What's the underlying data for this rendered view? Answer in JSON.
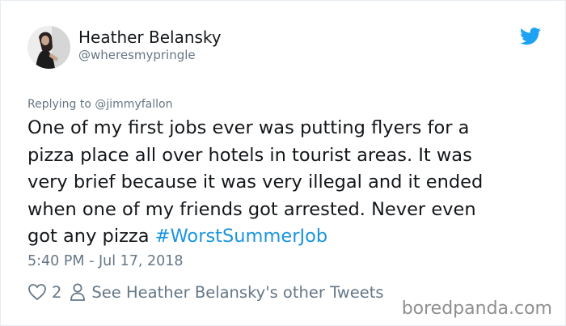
{
  "author": {
    "display_name": "Heather Belansky",
    "handle": "@wheresmypringle"
  },
  "reply": {
    "prefix": "Replying to",
    "mention": "@jimmyfallon"
  },
  "tweet": {
    "lines": [
      "One of my first jobs ever was putting flyers for a",
      "pizza place all over hotels in tourist areas. It was",
      "very brief because it was very illegal and it ended",
      "when one of my friends got arrested. Never even"
    ],
    "last_line_text": "got any pizza",
    "hashtag": "#WorstSummerJob",
    "timestamp": "5:40 PM - Jul 17, 2018"
  },
  "actions": {
    "like_count": "2",
    "profile_link": "See Heather Belansky's other Tweets"
  },
  "watermark": "boredpanda.com",
  "icons": {
    "avatar": "profile-photo",
    "brand": "twitter-bird-icon",
    "like": "heart-icon",
    "profile": "person-icon"
  },
  "colors": {
    "text": "#14171a",
    "secondary": "#657786",
    "accent": "#1b95e0",
    "bird": "#1da1f2",
    "border": "#e6ecf0"
  }
}
